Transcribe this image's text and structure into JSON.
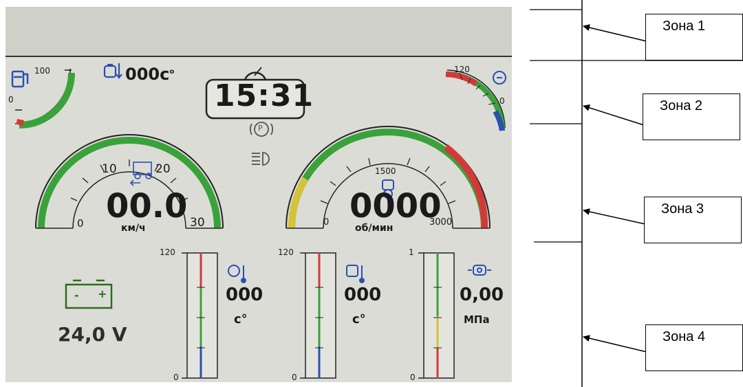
{
  "clock": {
    "time": "15:31"
  },
  "engine_hours": {
    "value": "000c",
    "unit_sup": "o"
  },
  "fuel_gauge": {
    "max_label": "100",
    "min_label": "0",
    "color_green": "#3aa23a",
    "color_red": "#d23a3a"
  },
  "oil_temp_small_gauge": {
    "max_label": "120",
    "min_label": "0"
  },
  "speedometer": {
    "ticks": [
      "0",
      "10",
      "20",
      "30"
    ],
    "value": "00.0",
    "unit": "км/ч"
  },
  "tachometer": {
    "ticks": [
      "0",
      "1500",
      "3000"
    ],
    "value": "0000",
    "unit": "об/мин"
  },
  "indicators": {
    "parking": "P"
  },
  "battery": {
    "minus": "-",
    "plus": "+",
    "voltage": "24,0 V"
  },
  "bar_gauges": [
    {
      "id": "transmission-oil-temp",
      "max_label": "120",
      "min_label": "0",
      "value": "000",
      "unit": "c°"
    },
    {
      "id": "coolant-temp",
      "max_label": "120",
      "min_label": "0",
      "value": "000",
      "unit": "c°"
    },
    {
      "id": "oil-pressure",
      "max_label": "1",
      "min_label": "0",
      "value": "0,00",
      "unit": "МПа"
    }
  ],
  "zones": [
    {
      "label": "Зона 1"
    },
    {
      "label": "Зона 2"
    },
    {
      "label": "Зона 3"
    },
    {
      "label": "Зона 4"
    }
  ],
  "colors": {
    "green": "#3aa23a",
    "red": "#d23a3a",
    "blue": "#2a4fb0",
    "yellow": "#d6c23a",
    "screen": "#dcdcd6"
  }
}
